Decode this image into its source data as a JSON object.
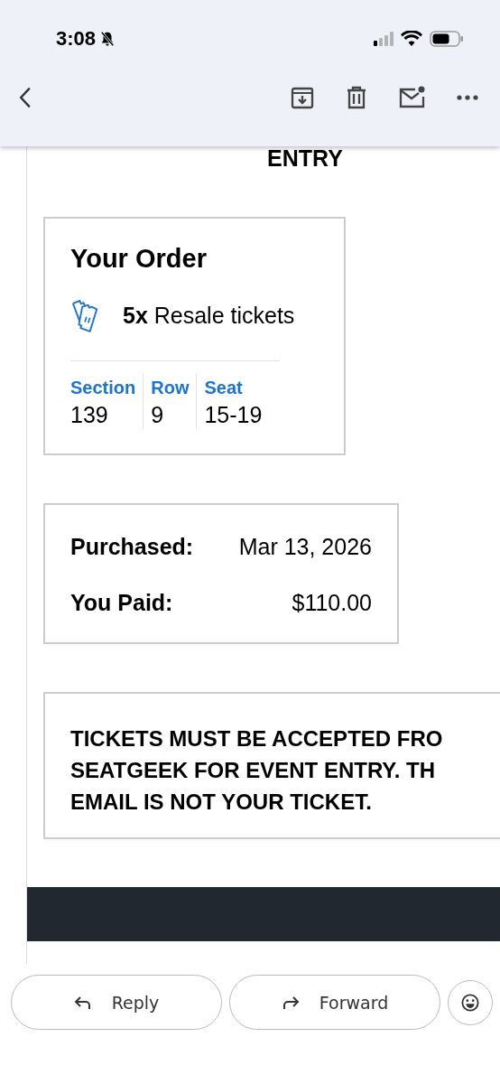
{
  "status_bar": {
    "time": "3:08",
    "silent": true
  },
  "toolbar": {
    "actions": [
      {
        "kind": "archive"
      },
      {
        "kind": "delete"
      },
      {
        "kind": "unread"
      },
      {
        "kind": "more"
      }
    ]
  },
  "email": {
    "heading_tail": "ENTRY",
    "order": {
      "title": "Your Order",
      "quantity": "5x",
      "ticket_type": "Resale tickets",
      "columns": [
        {
          "label": "Section",
          "value": "139"
        },
        {
          "label": "Row",
          "value": "9"
        },
        {
          "label": "Seat",
          "value": "15-19"
        }
      ]
    },
    "payment": [
      {
        "label": "Purchased:",
        "value": "Mar 13, 2026"
      },
      {
        "label": "You Paid:",
        "value": "$110.00"
      }
    ],
    "notice_lines": [
      "TICKETS MUST BE ACCEPTED FRO",
      "SEATGEEK FOR EVENT ENTRY. TH",
      "EMAIL IS NOT YOUR TICKET."
    ]
  },
  "actions": [
    {
      "kind": "reply",
      "label": "Reply"
    },
    {
      "kind": "forward",
      "label": "Forward"
    },
    {
      "kind": "react"
    }
  ]
}
